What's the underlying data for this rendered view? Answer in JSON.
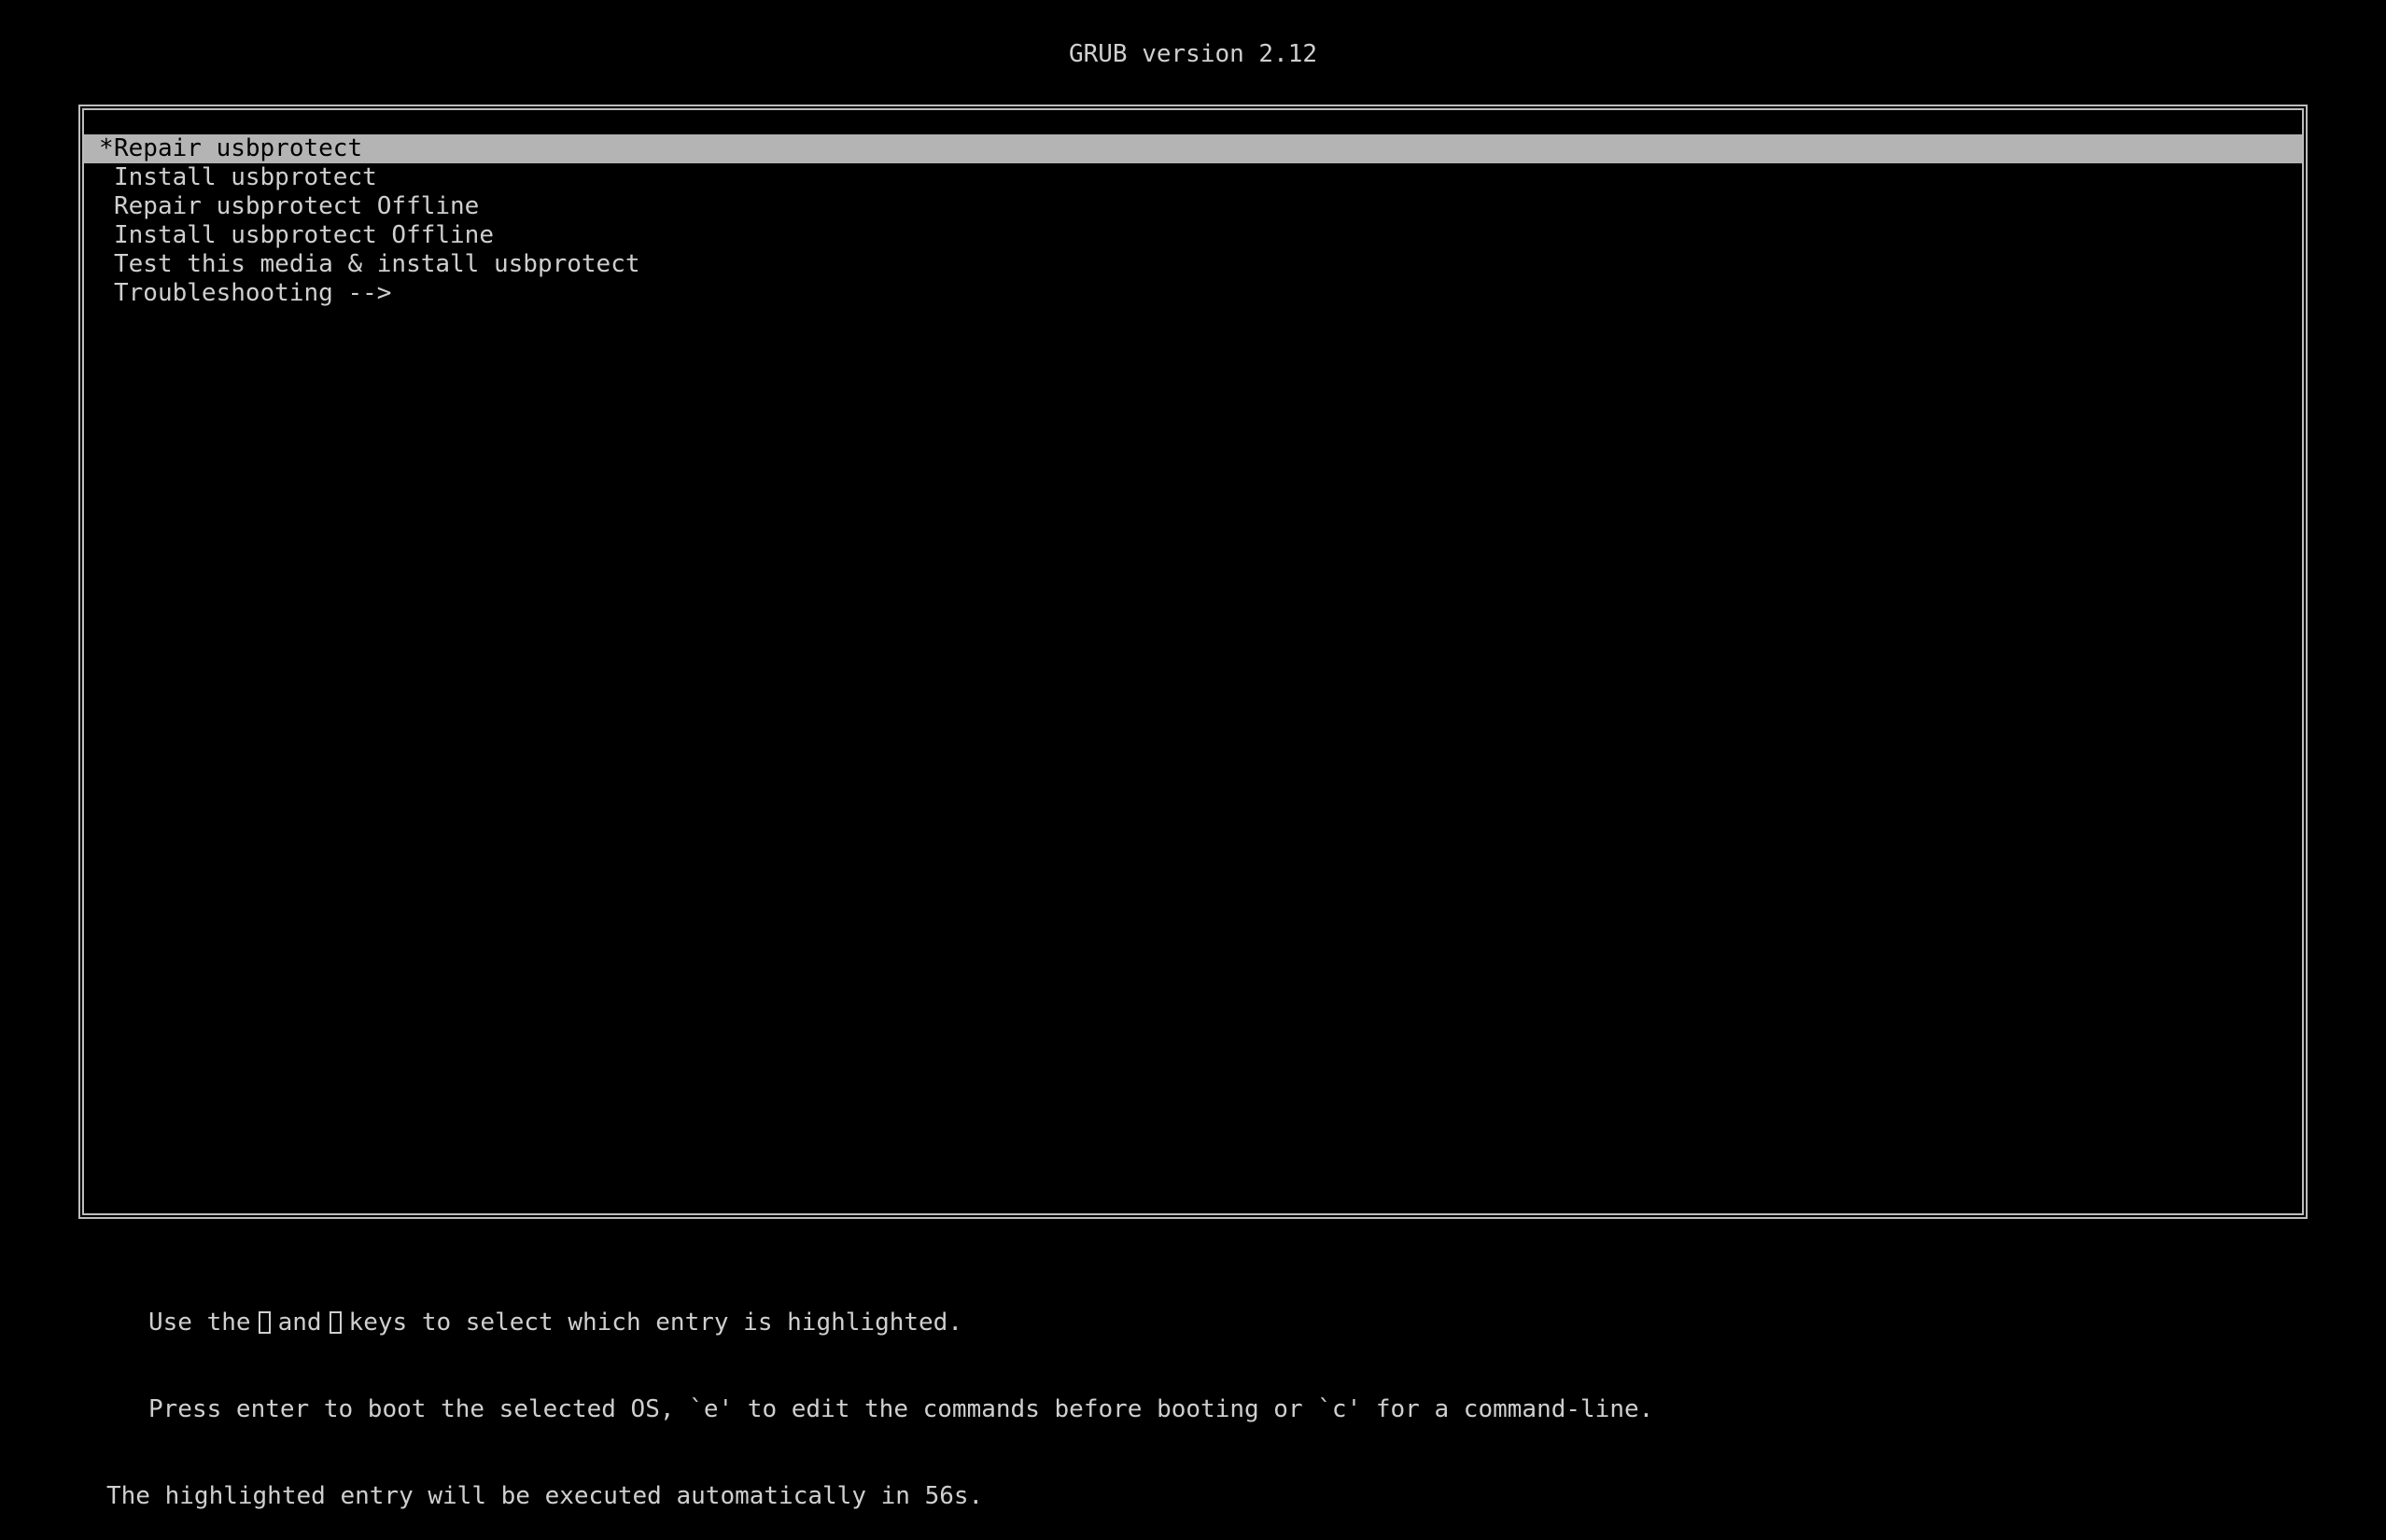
{
  "header": {
    "title": "GRUB version 2.12"
  },
  "menu": {
    "entries": [
      {
        "label": "Repair usbprotect",
        "marker": "*",
        "selected": true
      },
      {
        "label": "Install usbprotect",
        "marker": " ",
        "selected": false
      },
      {
        "label": "Repair usbprotect Offline",
        "marker": " ",
        "selected": false
      },
      {
        "label": "Install usbprotect Offline",
        "marker": " ",
        "selected": false
      },
      {
        "label": "Test this media & install usbprotect",
        "marker": " ",
        "selected": false
      },
      {
        "label": "Troubleshooting -->",
        "marker": " ",
        "selected": false
      }
    ]
  },
  "help": {
    "line1_prefix": "Use the",
    "line1_key_up_icon": "up-arrow-icon",
    "line1_and": "and",
    "line1_key_down_icon": "down-arrow-icon",
    "line1_suffix": "keys to select which entry is highlighted.",
    "line2": "Press enter to boot the selected OS, `e' to edit the commands before booting or `c' for a command-line.",
    "line3": "The highlighted entry will be executed automatically in 56s."
  },
  "colors": {
    "background": "#000000",
    "text": "#cfcfcf",
    "highlight": "#b4b4b4",
    "highlight_text": "#000000"
  }
}
